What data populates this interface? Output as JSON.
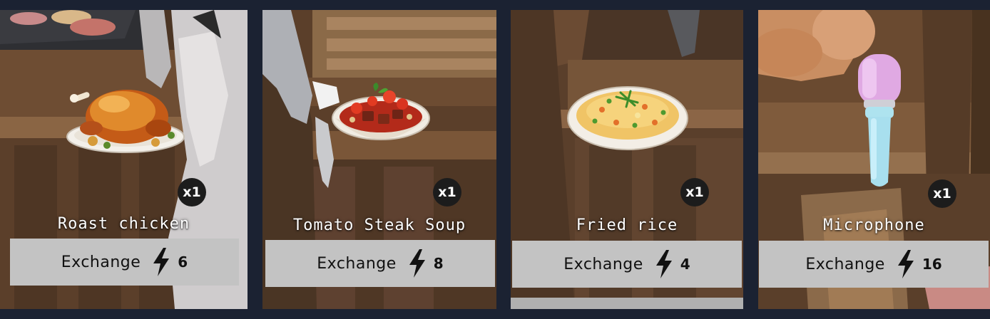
{
  "items": [
    {
      "name": "Roast chicken",
      "quantity": "x1",
      "button_label": "Exchange",
      "cost": "6",
      "icon": "roast-chicken-icon"
    },
    {
      "name": "Tomato Steak Soup",
      "quantity": "x1",
      "button_label": "Exchange",
      "cost": "8",
      "icon": "tomato-steak-soup-icon"
    },
    {
      "name": "Fried rice",
      "quantity": "x1",
      "button_label": "Exchange",
      "cost": "4",
      "icon": "fried-rice-icon"
    },
    {
      "name": "Microphone",
      "quantity": "x1",
      "button_label": "Exchange",
      "cost": "16",
      "icon": "microphone-icon"
    }
  ],
  "currency_icon": "lightning-bolt-icon",
  "colors": {
    "background": "#1b2232",
    "button": "#c3c3c3",
    "badge": "#1c1c1c"
  }
}
